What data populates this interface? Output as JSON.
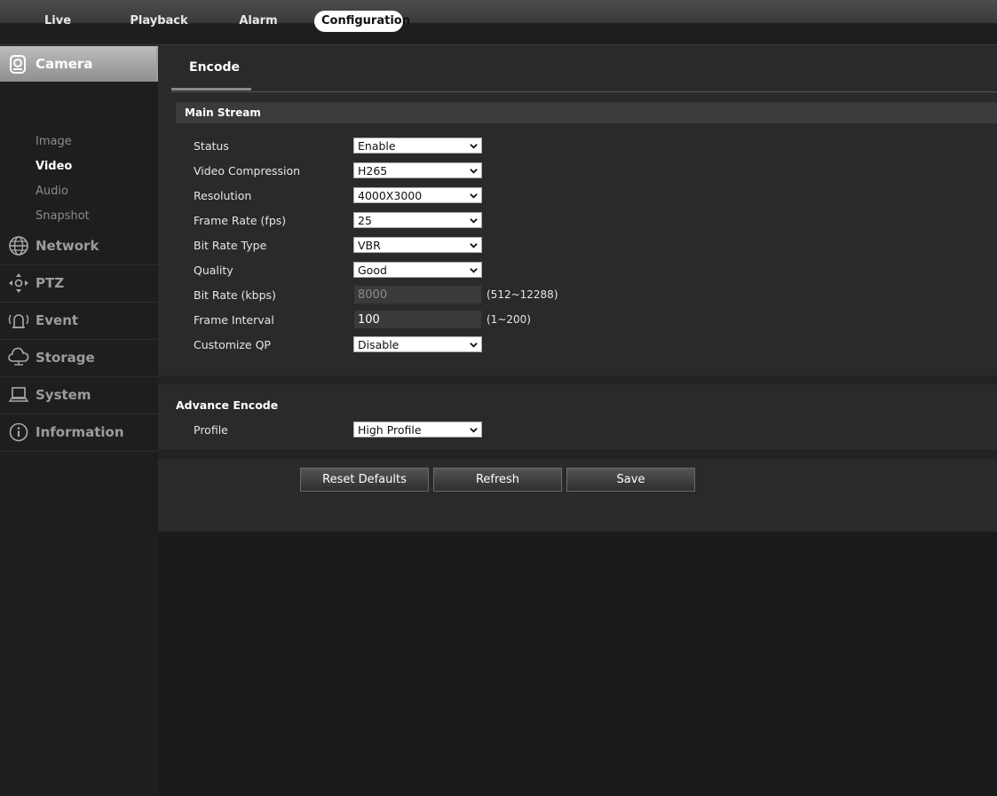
{
  "topnav": {
    "items": [
      {
        "label": "Live"
      },
      {
        "label": "Playback"
      },
      {
        "label": "Alarm"
      },
      {
        "label": "Configuration"
      }
    ],
    "active": "Configuration"
  },
  "sidebar": {
    "camera": {
      "label": "Camera",
      "subitems": [
        {
          "label": "Image"
        },
        {
          "label": "Video"
        },
        {
          "label": "Audio"
        },
        {
          "label": "Snapshot"
        }
      ],
      "active_subitem": "Video"
    },
    "items": [
      {
        "label": "Network",
        "icon": "globe-icon"
      },
      {
        "label": "PTZ",
        "icon": "ptz-directions-icon"
      },
      {
        "label": "Event",
        "icon": "alarm-bell-icon"
      },
      {
        "label": "Storage",
        "icon": "cloud-storage-icon"
      },
      {
        "label": "System",
        "icon": "laptop-icon"
      },
      {
        "label": "Information",
        "icon": "info-icon"
      }
    ]
  },
  "main": {
    "tab": {
      "label": "Encode"
    },
    "main_stream": {
      "title": "Main Stream",
      "rows": [
        {
          "label": "Status",
          "value": "Enable"
        },
        {
          "label": "Video Compression",
          "value": "H265"
        },
        {
          "label": "Resolution",
          "value": "4000X3000"
        },
        {
          "label": "Frame Rate (fps)",
          "value": "25"
        },
        {
          "label": "Bit Rate Type",
          "value": "VBR"
        },
        {
          "label": "Quality",
          "value": "Good"
        },
        {
          "label": "Bit Rate (kbps)",
          "value": "8000",
          "hint": "(512~12288)"
        },
        {
          "label": "Frame Interval",
          "value": "100",
          "hint": "(1~200)"
        },
        {
          "label": "Customize QP",
          "value": "Disable"
        }
      ]
    },
    "advance": {
      "title": "Advance Encode",
      "rows": [
        {
          "label": "Profile",
          "value": "High Profile"
        }
      ]
    },
    "buttons": {
      "reset": "Reset Defaults",
      "refresh": "Refresh",
      "save": "Save"
    }
  }
}
